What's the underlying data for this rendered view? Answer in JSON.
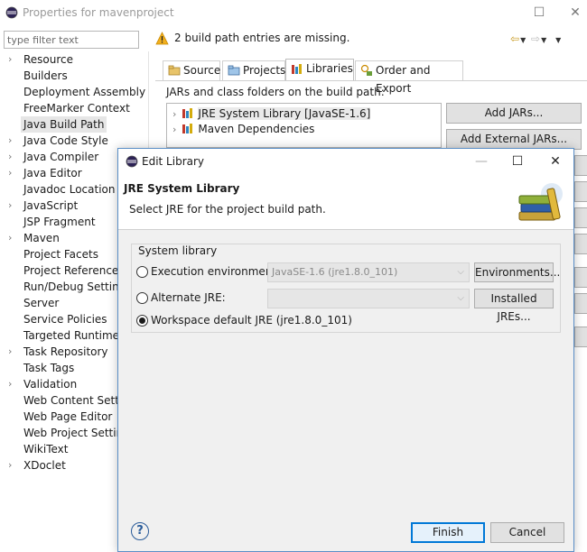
{
  "outer_window": {
    "title": "Properties for mavenproject",
    "filter_placeholder": "type filter text",
    "tree_items": [
      {
        "label": "Resource",
        "expandable": true
      },
      {
        "label": "Builders",
        "expandable": false
      },
      {
        "label": "Deployment Assembly",
        "expandable": false
      },
      {
        "label": "FreeMarker Context",
        "expandable": false
      },
      {
        "label": "Java Build Path",
        "expandable": false,
        "selected": true
      },
      {
        "label": "Java Code Style",
        "expandable": true
      },
      {
        "label": "Java Compiler",
        "expandable": true
      },
      {
        "label": "Java Editor",
        "expandable": true
      },
      {
        "label": "Javadoc Location",
        "expandable": false
      },
      {
        "label": "JavaScript",
        "expandable": true
      },
      {
        "label": "JSP Fragment",
        "expandable": false
      },
      {
        "label": "Maven",
        "expandable": true
      },
      {
        "label": "Project Facets",
        "expandable": false
      },
      {
        "label": "Project References",
        "expandable": false
      },
      {
        "label": "Run/Debug Settings",
        "expandable": false
      },
      {
        "label": "Server",
        "expandable": false
      },
      {
        "label": "Service Policies",
        "expandable": false
      },
      {
        "label": "Targeted Runtimes",
        "expandable": false
      },
      {
        "label": "Task Repository",
        "expandable": true
      },
      {
        "label": "Task Tags",
        "expandable": false
      },
      {
        "label": "Validation",
        "expandable": true
      },
      {
        "label": "Web Content Settings",
        "expandable": false
      },
      {
        "label": "Web Page Editor",
        "expandable": false
      },
      {
        "label": "Web Project Settings",
        "expandable": false
      },
      {
        "label": "WikiText",
        "expandable": false
      },
      {
        "label": "XDoclet",
        "expandable": true
      }
    ],
    "warning": "2 build path entries are missing.",
    "tabs": {
      "source": "Source",
      "projects": "Projects",
      "libraries": "Libraries",
      "order": "Order and Export"
    },
    "jars_label": "JARs and class folders on the build path:",
    "libraries": [
      {
        "label": "JRE System Library [JavaSE-1.6]"
      },
      {
        "label": "Maven Dependencies"
      }
    ],
    "buttons": {
      "add_jars": "Add JARs...",
      "add_external_jars": "Add External JARs..."
    }
  },
  "dialog": {
    "title": "Edit Library",
    "heading": "JRE System Library",
    "description": "Select JRE for the project build path.",
    "group_label": "System library",
    "options": {
      "execution_env_label": "Execution environment:",
      "execution_env_value": "JavaSE-1.6 (jre1.8.0_101)",
      "alternate_jre_label": "Alternate JRE:",
      "alternate_jre_value": "",
      "workspace_default_label": "Workspace default JRE (jre1.8.0_101)",
      "selected": "workspace_default"
    },
    "buttons": {
      "environments": "Environments...",
      "installed_jres": "Installed JREs...",
      "finish": "Finish",
      "cancel": "Cancel"
    }
  },
  "colors": {
    "dialog_border": "#5b8fc7",
    "default_button_border": "#0078d7",
    "warning": "#f2b01e"
  }
}
